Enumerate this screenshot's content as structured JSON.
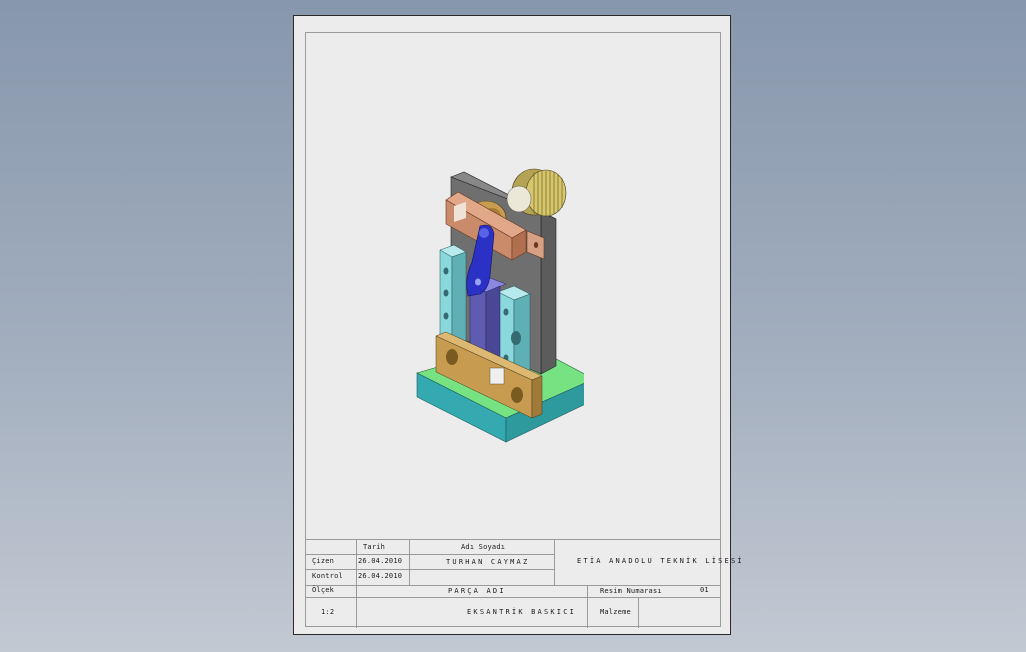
{
  "title_block": {
    "tarih_header": "Tarih",
    "adi_soyadi_header": "Adı Soyadı",
    "cizen_label": "Çizen",
    "cizen_date": "26.04.2010",
    "cizen_name": "TURHAN CAYMAZ",
    "kontrol_label": "Kontrol",
    "kontrol_date": "26.04.2010",
    "company": "ETİA ANADOLU TEKNİK LİSESİ",
    "olcek_label": "Ölçek",
    "scale": "1:2",
    "parca_adi_label": "PARÇA ADI",
    "part_name": "EKSANTRİK BASKICI",
    "resim_numarasi_label": "Resim Numarası",
    "resim_numarasi": "01",
    "malzeme_label": "Malzeme"
  },
  "model": {
    "icon": "isometric-assembly-view",
    "colors": {
      "base_top": "#76e282",
      "base_side": "#2e9a9e",
      "base_front": "#34aab0",
      "column": "#5c5c5c",
      "column_front": "#777777",
      "cyan_block": "#8bd8dc",
      "bronze_block": "#c89c50",
      "bracket": "#c98b6a",
      "lever": "#2a31c4",
      "slider": "#5e5cb0",
      "knurled_knob": "#d6c66c"
    }
  }
}
